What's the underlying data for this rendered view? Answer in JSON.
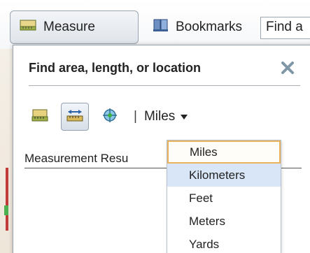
{
  "toolbar": {
    "measure_label": "Measure",
    "bookmarks_label": "Bookmarks",
    "find_text": "Find a"
  },
  "panel": {
    "title": "Find area, length, or location",
    "separator": "|",
    "current_unit": "Miles",
    "result_label": "Measurement Resu"
  },
  "units": {
    "options": [
      "Miles",
      "Kilometers",
      "Feet",
      "Meters",
      "Yards"
    ],
    "focused": "Miles",
    "highlighted": "Kilometers"
  },
  "colors": {
    "focus_border": "#e9b25c",
    "highlight": "#d8e6f7",
    "close_x": "#7f97a6"
  }
}
